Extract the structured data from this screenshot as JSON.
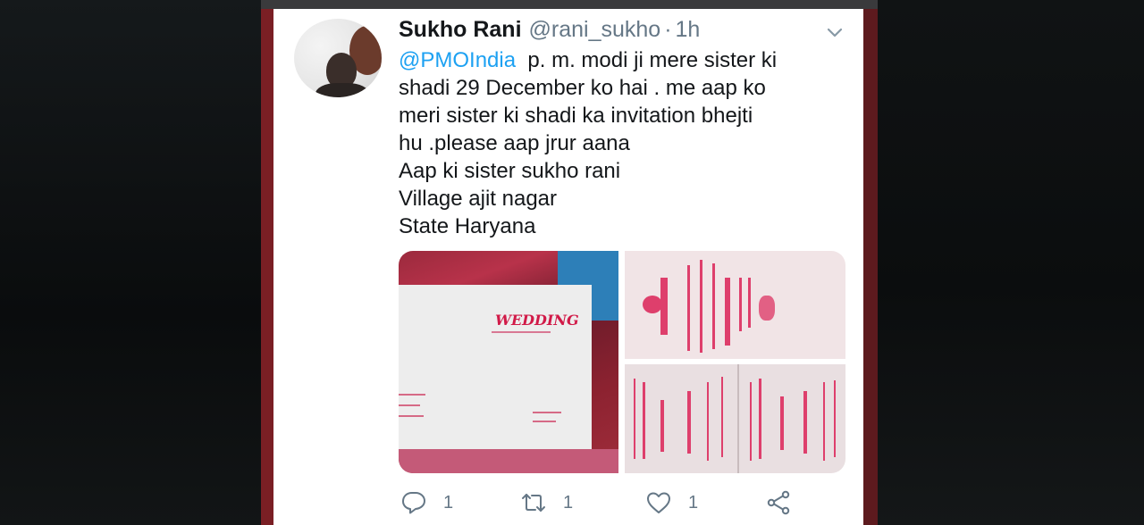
{
  "tweet": {
    "display_name": "Sukho Rani",
    "handle": "@rani_sukho",
    "separator": "·",
    "time": "1h",
    "mention": "@PMOIndia",
    "text_lines": [
      "p. m. modi ji  mere sister ki",
      "shadi 29 December  ko hai . me aap ko",
      "meri sister ki shadi ka invitation bhejti",
      "hu .please aap jrur aana",
      "Aap ki sister  sukho rani",
      "Village ajit nagar",
      "State Haryana"
    ],
    "card_text": "WEDDING"
  },
  "actions": {
    "reply_count": "1",
    "retweet_count": "1",
    "like_count": "1"
  },
  "colors": {
    "link": "#1da1f2",
    "muted": "#657786",
    "text": "#14171a"
  },
  "icons": {
    "reply": "reply-icon",
    "retweet": "retweet-icon",
    "like": "heart-icon",
    "share": "share-icon",
    "menu": "chevron-down-icon"
  }
}
